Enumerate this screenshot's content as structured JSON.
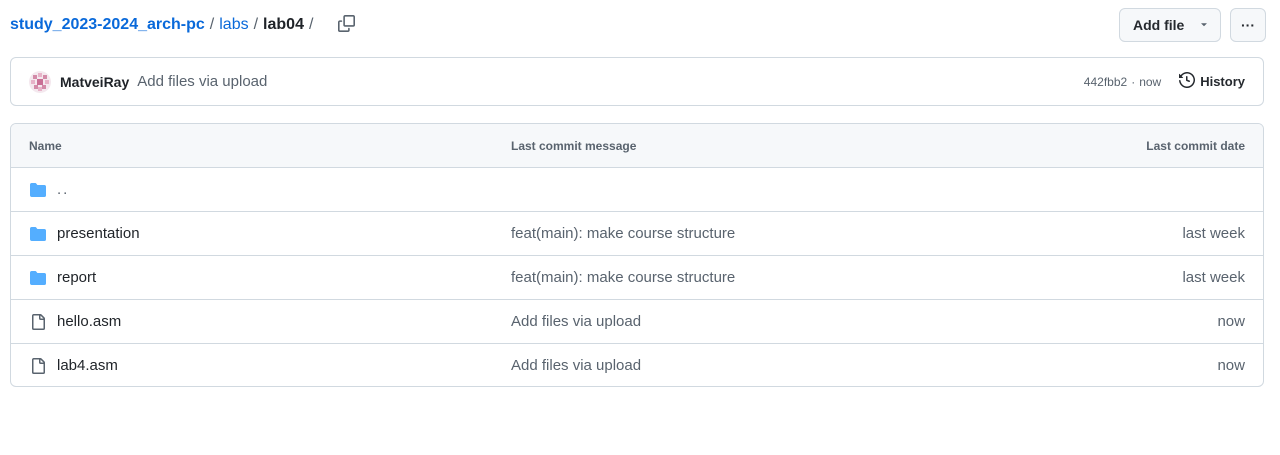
{
  "breadcrumb": {
    "repo": "study_2023-2024_arch-pc",
    "folder": "labs",
    "current": "lab04",
    "separator": "/"
  },
  "toolbar": {
    "add_file_label": "Add file",
    "more_label": "···"
  },
  "commit": {
    "author": "MatveiRay",
    "message": "Add files via upload",
    "sha": "442fbb2",
    "dot": "·",
    "time": "now",
    "history_label": "History"
  },
  "table": {
    "headers": {
      "name": "Name",
      "message": "Last commit message",
      "date": "Last commit date"
    },
    "rows": [
      {
        "type": "folder",
        "name": "..",
        "message": "",
        "date": ""
      },
      {
        "type": "folder",
        "name": "presentation",
        "message": "feat(main): make course structure",
        "date": "last week"
      },
      {
        "type": "folder",
        "name": "report",
        "message": "feat(main): make course structure",
        "date": "last week"
      },
      {
        "type": "file",
        "name": "hello.asm",
        "message": "Add files via upload",
        "date": "now"
      },
      {
        "type": "file",
        "name": "lab4.asm",
        "message": "Add files via upload",
        "date": "now"
      }
    ]
  },
  "icons": {
    "copy": "copy-icon",
    "caret": "triangle-down-icon",
    "history": "history-icon",
    "folder": "folder-icon",
    "file": "file-icon"
  },
  "colors": {
    "link": "#0969da",
    "folder": "#54aeff",
    "muted": "#59636e",
    "border": "#d1d9e0",
    "header_bg": "#f6f8fa"
  }
}
